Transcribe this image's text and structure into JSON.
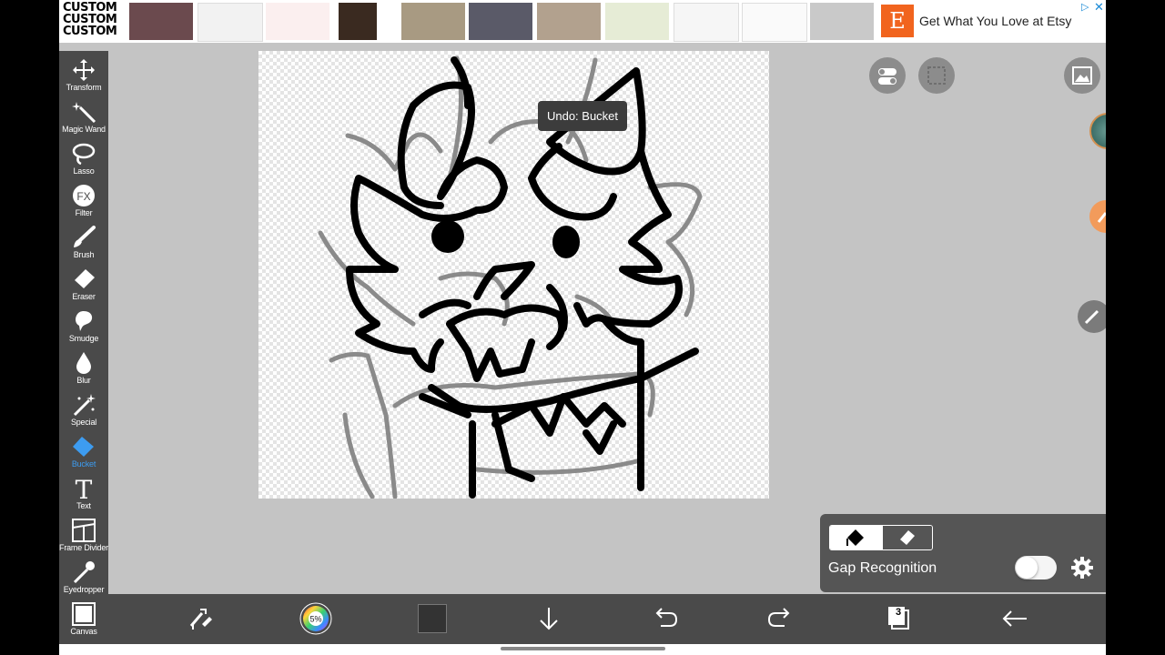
{
  "ad": {
    "logo_text_lines": [
      "CUSTOM",
      "CUSTOM",
      "CUSTOM"
    ],
    "etsy_letter": "E",
    "headline": "Get What You Love at Etsy",
    "adchoices_icon": "adchoices-icon",
    "close_icon": "close-icon"
  },
  "toolbar": {
    "items": [
      {
        "label": "Transform",
        "icon": "move-arrows-icon"
      },
      {
        "label": "Magic Wand",
        "icon": "magic-wand-icon"
      },
      {
        "label": "Lasso",
        "icon": "lasso-icon"
      },
      {
        "label": "Filter",
        "icon": "fx-icon",
        "glyph": "FX"
      },
      {
        "label": "Brush",
        "icon": "brush-icon"
      },
      {
        "label": "Eraser",
        "icon": "eraser-icon"
      },
      {
        "label": "Smudge",
        "icon": "smudge-icon"
      },
      {
        "label": "Blur",
        "icon": "drop-icon"
      },
      {
        "label": "Special",
        "icon": "sparkle-wand-icon"
      },
      {
        "label": "Bucket",
        "icon": "bucket-icon",
        "active": true
      },
      {
        "label": "Text",
        "icon": "text-icon",
        "glyph": "T"
      },
      {
        "label": "Frame Divider",
        "icon": "frame-divider-icon"
      },
      {
        "label": "Eyedropper",
        "icon": "eyedropper-icon"
      },
      {
        "label": "Canvas",
        "icon": "canvas-icon"
      }
    ],
    "active_color": "#3d9cf0"
  },
  "canvas": {
    "tooltip": "Undo: Bucket"
  },
  "bucket_panel": {
    "modes": [
      "fill",
      "erase"
    ],
    "selected_mode": "fill",
    "gap_label": "Gap Recognition",
    "gap_enabled": false
  },
  "bottombar": {
    "color_wheel_value": "5%",
    "current_color": "#333333",
    "layer_count": "3",
    "icons": [
      "transform-swap-icon",
      "color-wheel-icon",
      "color-swatch-icon",
      "download-arrow-icon",
      "undo-icon",
      "redo-icon",
      "layers-icon",
      "back-arrow-icon"
    ]
  },
  "colors": {
    "toolbar_bg": "#4a4a4a",
    "workspace_bg": "#c4c4c4",
    "etsy_orange": "#f1641e"
  }
}
